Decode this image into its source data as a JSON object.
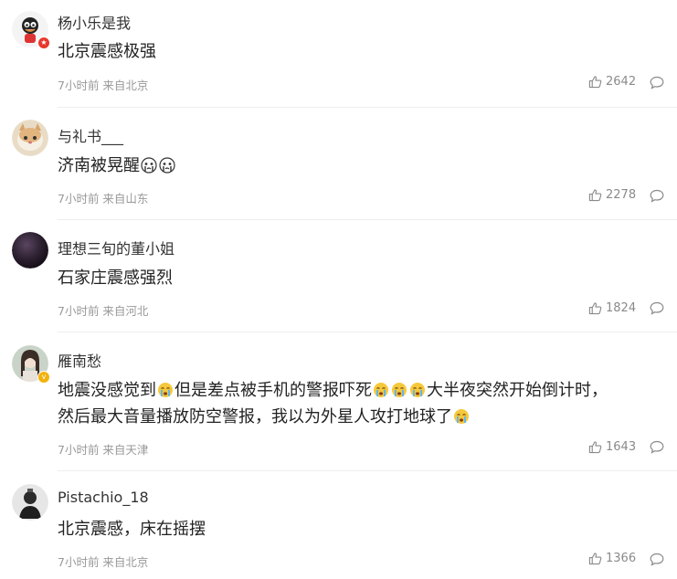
{
  "comments": [
    {
      "username": "杨小乐是我",
      "content": "北京震感极强",
      "meta": "7小时前 来自北京",
      "likes": "2642",
      "avatar_badge": "red-v-badge"
    },
    {
      "username": "与礼书___",
      "content": "济南被晃醒",
      "content_emoji": "crying-face-emoji",
      "meta": "7小时前 来自山东",
      "likes": "2278"
    },
    {
      "username": "理想三旬的董小姐",
      "content": "石家庄震感强烈",
      "meta": "7小时前 来自河北",
      "likes": "1824"
    },
    {
      "username": "雁南愁",
      "content_part1": "地震没感觉到",
      "content_part2": "但是差点被手机的警报吓死",
      "content_part3": "大半夜突然开始倒计时，",
      "content_line2": "然后最大音量播放防空警报，我以为外星人攻打地球了",
      "meta": "7小时前 来自天津",
      "likes": "1643",
      "avatar_badge": "yellow-v-badge"
    },
    {
      "username": "Pistachio_18",
      "content": "北京震感，床在摇摆",
      "meta": "7小时前 来自北京",
      "likes": "1366"
    }
  ],
  "colors": {
    "text": "#333333",
    "meta": "#999999",
    "divider": "#eeeeee",
    "badge_red": "#e8372c",
    "badge_yellow": "#f2b20c"
  }
}
